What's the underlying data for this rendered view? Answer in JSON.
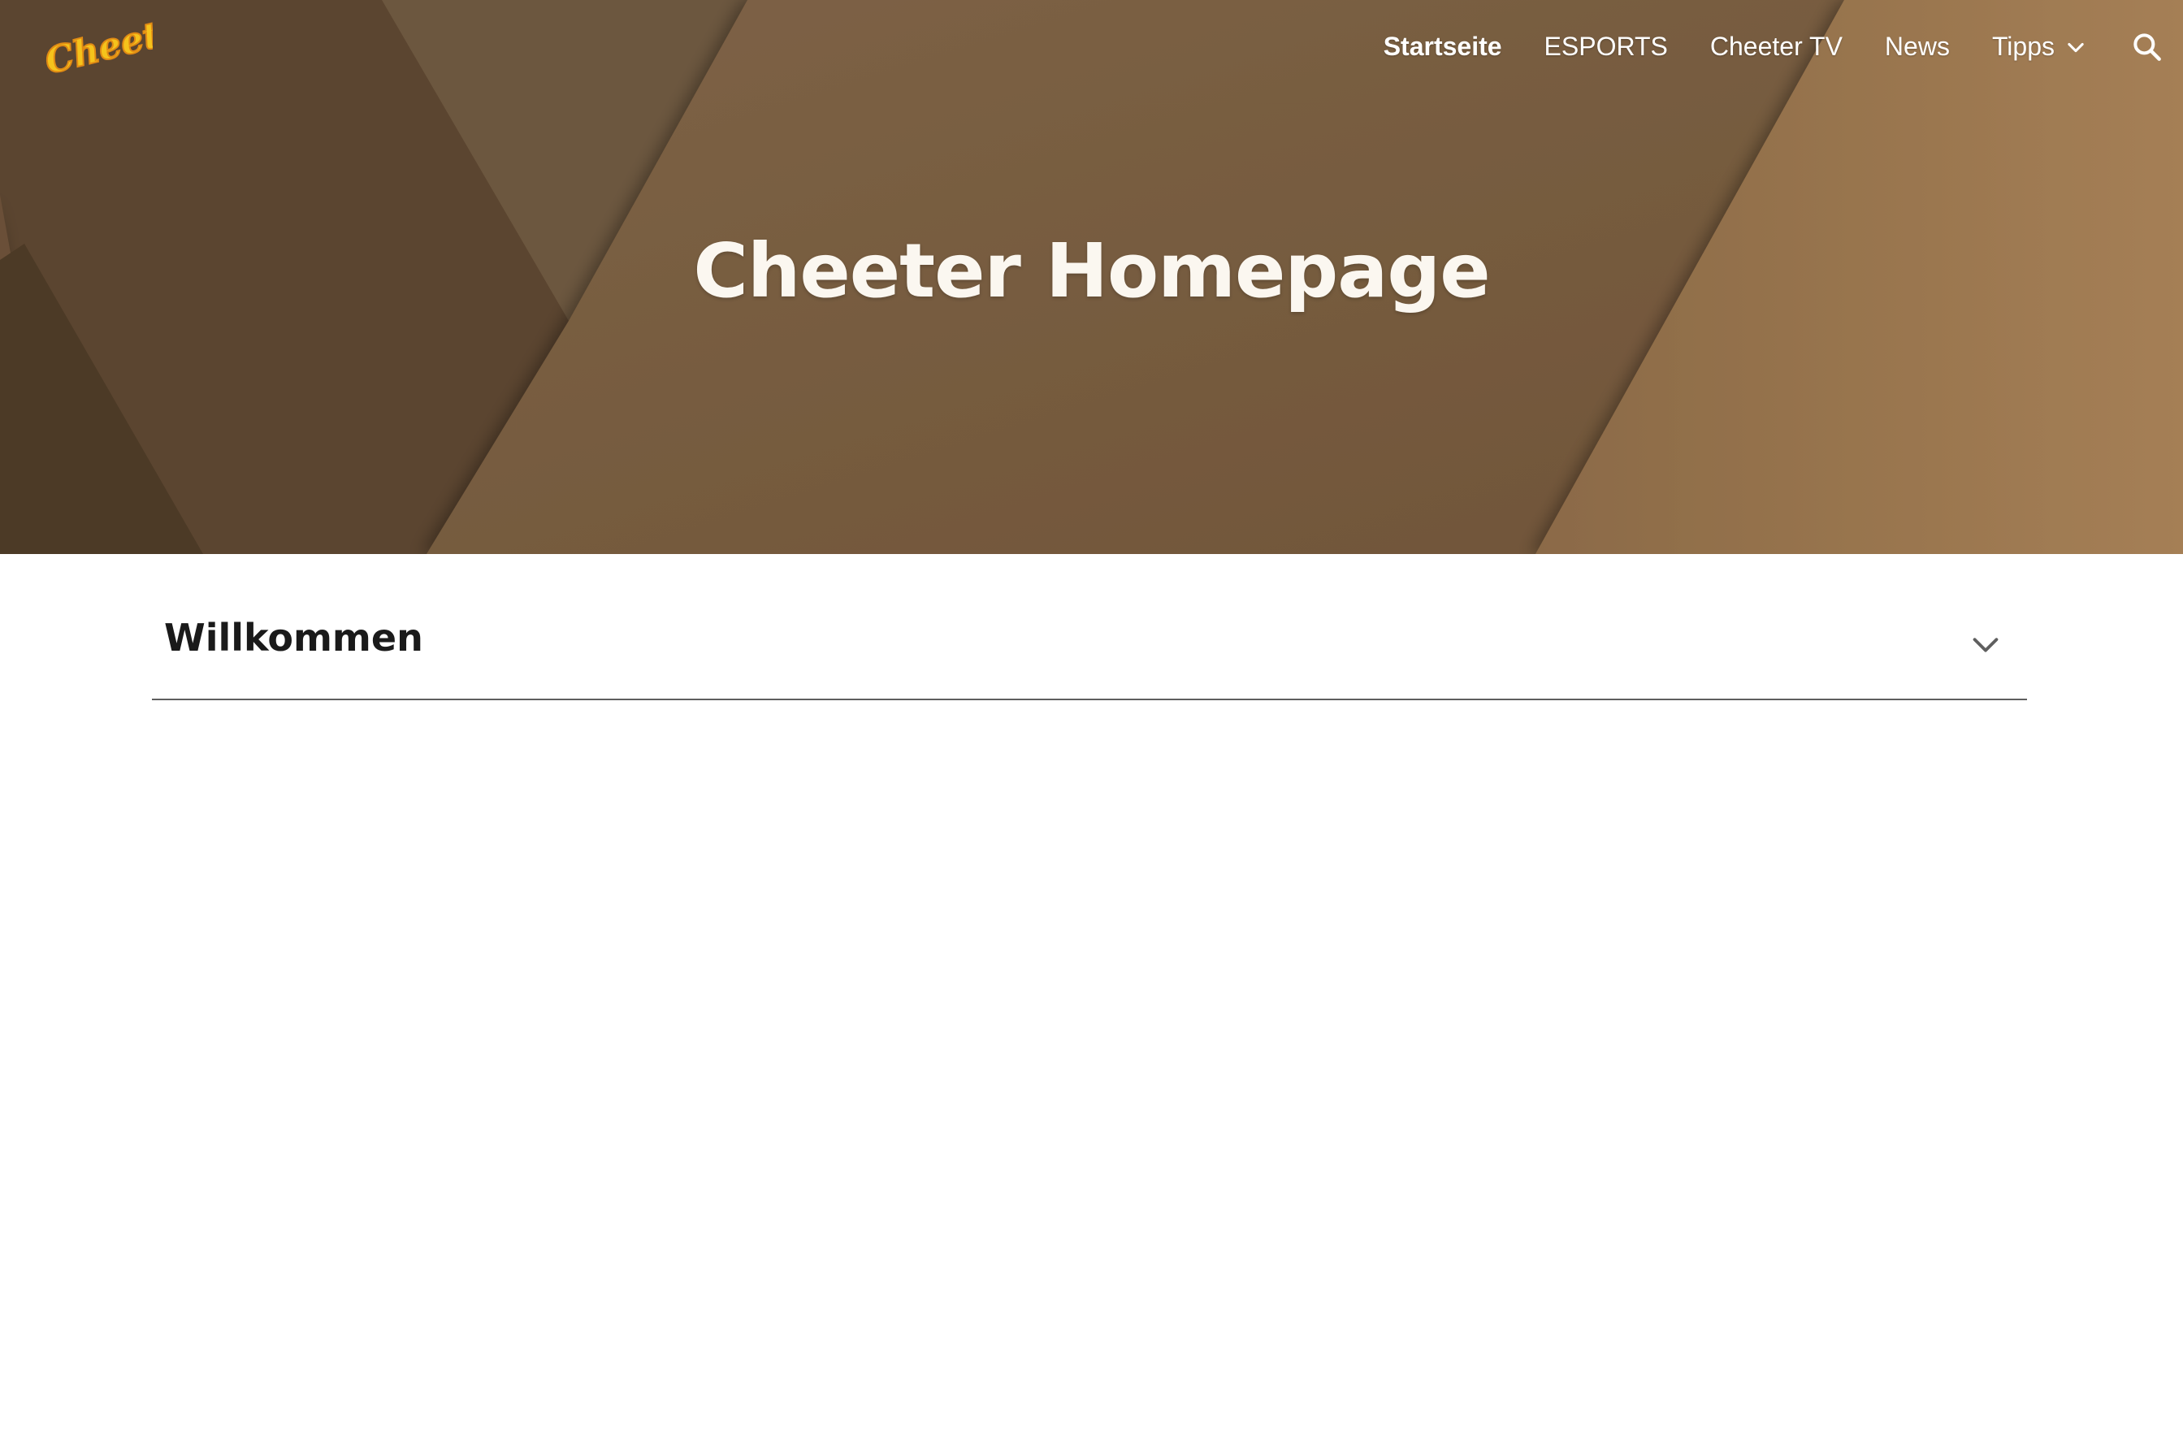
{
  "colors": {
    "hero_base": "#765c3e",
    "logo_yellow": "#f5c31c",
    "logo_orange": "#e08a14",
    "nav_text": "#ffffff",
    "title_text": "#fbf7f0",
    "section_title": "#1a1a1a",
    "divider": "#5f5f5f"
  },
  "header": {
    "logo_text": "Cheeter",
    "nav": [
      {
        "label": "Startseite",
        "active": true
      },
      {
        "label": "ESPORTS"
      },
      {
        "label": "Cheeter TV"
      },
      {
        "label": "News"
      },
      {
        "label": "Tipps",
        "has_dropdown": true
      }
    ],
    "search_icon": "search-icon",
    "dropdown_icon": "chevron-down-icon"
  },
  "hero": {
    "title": "Cheeter Homepage"
  },
  "main": {
    "section": {
      "title": "Willkommen",
      "icon": "chevron-down-icon"
    }
  }
}
